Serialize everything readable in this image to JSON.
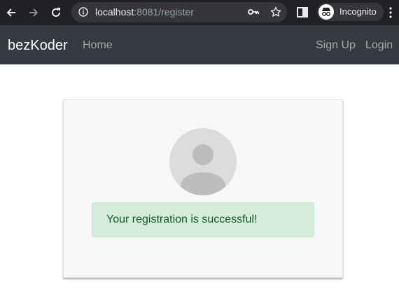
{
  "browser": {
    "url_host": "localhost",
    "url_rest": ":8081/register",
    "profile_label": "Incognito",
    "icons": [
      "back-icon",
      "forward-icon",
      "reload-icon",
      "info-icon",
      "key-icon",
      "star-icon",
      "side-panel-icon",
      "incognito-icon",
      "menu-icon"
    ]
  },
  "navbar": {
    "brand": "bezKoder",
    "home": "Home",
    "signup": "Sign Up",
    "login": "Login"
  },
  "card": {
    "profile_icon": "user-avatar-icon",
    "alert_message": "Your registration is successful!"
  },
  "colors": {
    "navbar_bg": "#343a40",
    "alert_bg": "#d4edda",
    "alert_text": "#155724",
    "chrome_bg": "#202124"
  }
}
